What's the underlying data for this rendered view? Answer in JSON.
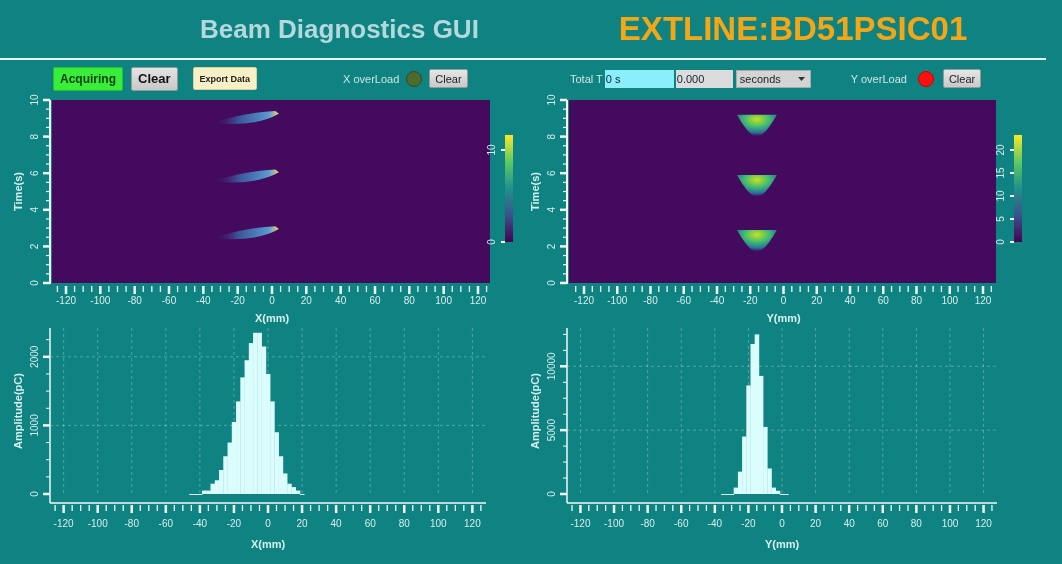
{
  "header": {
    "title": "Beam Diagnostics GUI",
    "device": "EXTLINE:BD51PSIC01"
  },
  "panels": [
    {
      "controls": [
        {
          "kind": "toggle",
          "label": "Acquiring",
          "active": true
        },
        {
          "kind": "button",
          "label": "Clear"
        },
        {
          "kind": "button",
          "label": "Export Data"
        },
        {
          "kind": "label",
          "label": "X overLoad"
        },
        {
          "kind": "indicator",
          "on": false
        },
        {
          "kind": "button",
          "label": "Clear"
        }
      ],
      "heatmap": {
        "ylabel": "Time(s)",
        "yticks": [
          "0",
          "2",
          "4",
          "6",
          "8",
          "10"
        ],
        "xticks": [
          "-120",
          "-100",
          "-80",
          "-60",
          "-40",
          "-20",
          "0",
          "20",
          "40",
          "60",
          "80",
          "100",
          "120"
        ],
        "xlabel": "X(mm)",
        "colorbar_ticks": [
          "0",
          "10"
        ],
        "kind": "picture"
      },
      "histogram": {
        "chart_data": {
          "type": "bar",
          "grid": true,
          "xlabel": "X(mm)",
          "ylabel": "Amplitude(pC)",
          "xlim": [
            -128,
            128
          ],
          "ylim": [
            0,
            2420
          ],
          "xticks": [
            -120,
            -100,
            -80,
            -60,
            -40,
            -20,
            0,
            20,
            40,
            60,
            80,
            100,
            120
          ],
          "yticks": [
            0,
            1000,
            2000
          ],
          "x": [
            -45,
            -42.5,
            -40,
            -37.5,
            -35,
            -32.5,
            -30,
            -27.5,
            -25,
            -22.5,
            -20,
            -17.5,
            -15,
            -12.5,
            -10,
            -7.5,
            -5,
            -2.5,
            0,
            2.5,
            5,
            7.5,
            10,
            12.5,
            15,
            17.5,
            20
          ],
          "values": [
            0,
            0,
            0,
            50,
            50,
            150,
            200,
            350,
            550,
            750,
            1050,
            1350,
            1700,
            1950,
            2200,
            2350,
            2350,
            2150,
            1750,
            1350,
            900,
            550,
            300,
            150,
            100,
            50,
            0
          ]
        }
      }
    },
    {
      "controls": [
        {
          "kind": "label",
          "label": "Total T"
        },
        {
          "kind": "input",
          "value": "0 s"
        },
        {
          "kind": "input",
          "value": "0.000"
        },
        {
          "kind": "dropdown",
          "value": "seconds"
        },
        {
          "kind": "label",
          "label": "Y overLoad"
        },
        {
          "kind": "indicator",
          "on": true
        },
        {
          "kind": "button",
          "label": "Clear"
        }
      ],
      "heatmap": {
        "ylabel": "Time(s)",
        "yticks": [
          "0",
          "2",
          "4",
          "6",
          "8",
          "10"
        ],
        "xticks": [
          "-120",
          "-100",
          "-80",
          "-60",
          "-40",
          "-20",
          "0",
          "20",
          "40",
          "60",
          "80",
          "100",
          "120"
        ],
        "xlabel": "Y(mm)",
        "colorbar_ticks": [
          "0",
          "5",
          "10",
          "15",
          "20"
        ],
        "kind": "picture"
      },
      "histogram": {
        "chart_data": {
          "type": "bar",
          "grid": true,
          "xlabel": "Y(mm)",
          "ylabel": "Amplitude(pC)",
          "xlim": [
            -128,
            128
          ],
          "ylim": [
            0,
            13000
          ],
          "xticks": [
            -120,
            -100,
            -80,
            -60,
            -40,
            -20,
            0,
            20,
            40,
            60,
            80,
            100,
            120
          ],
          "yticks": [
            0,
            5000,
            10000
          ],
          "x": [
            -35,
            -32.5,
            -30,
            -27.5,
            -25,
            -22.5,
            -20,
            -17.5,
            -15,
            -12.5,
            -10,
            -7.5,
            -5,
            -2.5,
            0,
            2.5
          ],
          "values": [
            0,
            0,
            0,
            500,
            1750,
            4500,
            8500,
            11750,
            12500,
            9250,
            5250,
            2000,
            500,
            250,
            0,
            0
          ]
        }
      }
    }
  ]
}
